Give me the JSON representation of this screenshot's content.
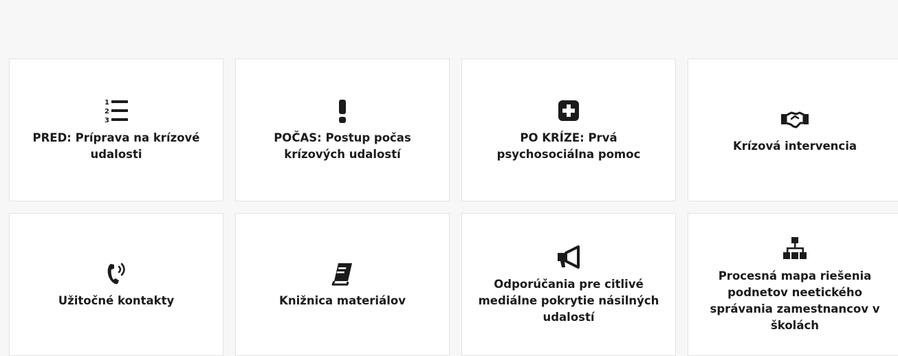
{
  "tiles": [
    {
      "label": "PRED: Príprava na krízové udalosti",
      "icon": "numbered-list-icon"
    },
    {
      "label": "POČAS: Postup počas krízových udalostí",
      "icon": "exclamation-icon"
    },
    {
      "label": "PO KRÍZE: Prvá psychosociálna pomoc",
      "icon": "plus-square-icon"
    },
    {
      "label": "Krízová intervencia",
      "icon": "handshake-icon"
    },
    {
      "label": "Užitočné kontakty",
      "icon": "phone-volume-icon"
    },
    {
      "label": "Knižnica materiálov",
      "icon": "book-icon"
    },
    {
      "label": "Odporúčania pre citlivé mediálne pokrytie násilných udalostí",
      "icon": "megaphone-icon"
    },
    {
      "label": "Procesná mapa riešenia podnetov neetického správania zamestnancov v školách",
      "icon": "sitemap-icon"
    }
  ],
  "icon_numbers": [
    "1",
    "2",
    "3"
  ],
  "colors": {
    "background": "#f7f7f7",
    "card": "#ffffff",
    "text": "#1b1b1b",
    "border": "#e3e3e3"
  }
}
